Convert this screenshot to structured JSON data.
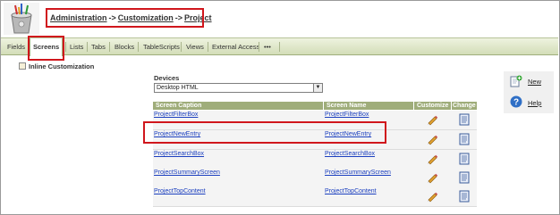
{
  "breadcrumb": {
    "items": [
      "Administration",
      "Customization",
      "Project"
    ],
    "separator": "->"
  },
  "tabs": [
    "Fields",
    "Screens",
    "Lists",
    "Tabs",
    "Blocks",
    "TableScripts",
    "Views",
    "External Access",
    "•••"
  ],
  "active_tab": "Screens",
  "inline_customization": {
    "label": "Inline Customization",
    "checked": false
  },
  "devices": {
    "label": "Devices",
    "selected": "Desktop HTML"
  },
  "grid": {
    "columns": [
      "Screen Caption",
      "Screen Name",
      "Customize",
      "Change"
    ],
    "rows": [
      {
        "caption": "ProjectFilterBox",
        "name": "ProjectFilterBox"
      },
      {
        "caption": "ProjectNewEntry",
        "name": "ProjectNewEntry"
      },
      {
        "caption": "ProjectSearchBox",
        "name": "ProjectSearchBox"
      },
      {
        "caption": "ProjectSummaryScreen",
        "name": "ProjectSummaryScreen"
      },
      {
        "caption": "ProjectTopContent",
        "name": "ProjectTopContent"
      }
    ]
  },
  "actions": {
    "new_label": "New",
    "help_label": "Help"
  },
  "colors": {
    "highlight": "#d0161c",
    "tab_bar": "#d3ddb8",
    "grid_header": "#9fad7a",
    "link": "#1b3fbf"
  }
}
